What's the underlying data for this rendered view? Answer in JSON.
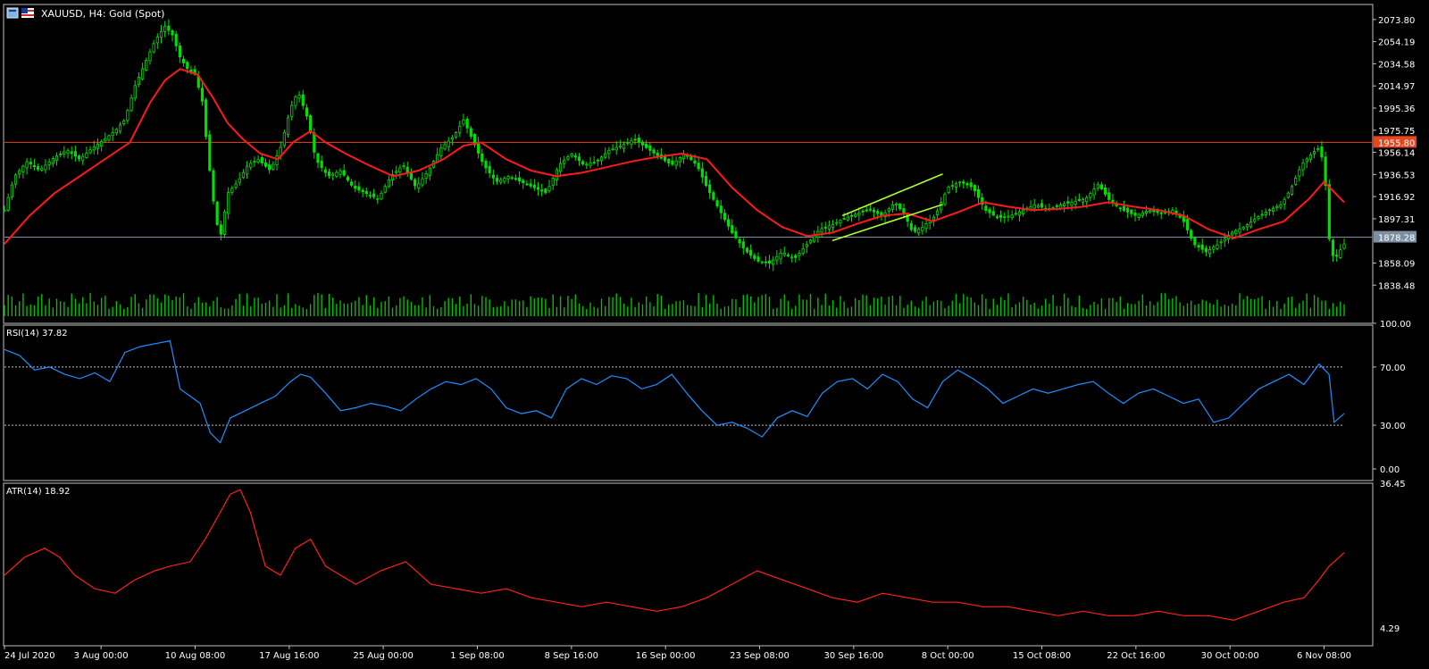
{
  "window": {
    "title": "XAUUSD, H4:  Gold (Spot)",
    "icon_names": [
      "chart-window-icon",
      "flag-icon"
    ]
  },
  "colors": {
    "background": "#000000",
    "frame": "#c0c0c0",
    "text": "#ffffff",
    "candle": "#00e000",
    "volume": "#00c000",
    "ma": "#ff1a1a",
    "resistance_line": "#e5461e",
    "support_line": "#7d8fa3",
    "channel": "#adff2f",
    "rsi": "#1e90ff",
    "atr": "#ff2020",
    "level_dotted": "#c0c0c0"
  },
  "chart_data": [
    {
      "name": "main",
      "type": "candlestick",
      "symbol": "XAUUSD",
      "timeframe": "H4",
      "title": "XAUUSD, H4:  Gold (Spot)",
      "ylim": [
        1830,
        2080
      ],
      "y_ticks": [
        "2073.80",
        "2054.19",
        "2034.58",
        "2014.97",
        "1995.36",
        "1975.75",
        "1956.14",
        "1936.53",
        "1916.92",
        "1897.31",
        "1858.09",
        "1838.48"
      ],
      "x_ticks": [
        "24 Jul 2020",
        "3 Aug 00:00",
        "10 Aug 08:00",
        "17 Aug 16:00",
        "25 Aug 00:00",
        "1 Sep 08:00",
        "8 Sep 16:00",
        "16 Sep 00:00",
        "23 Sep 08:00",
        "30 Sep 16:00",
        "8 Oct 00:00",
        "15 Oct 08:00",
        "22 Oct 16:00",
        "30 Oct 00:00",
        "6 Nov 08:00"
      ],
      "horizontal_lines": [
        {
          "label": "1955.80",
          "value": 1965
        },
        {
          "label": "1878.28",
          "value": 1881
        }
      ],
      "close_path": [
        {
          "x": 0,
          "y": 1905
        },
        {
          "x": 0.4,
          "y": 1935
        },
        {
          "x": 0.9,
          "y": 1948
        },
        {
          "x": 1.4,
          "y": 1940
        },
        {
          "x": 2.0,
          "y": 1952
        },
        {
          "x": 2.5,
          "y": 1958
        },
        {
          "x": 3.0,
          "y": 1950
        },
        {
          "x": 3.5,
          "y": 1960
        },
        {
          "x": 4.0,
          "y": 1968
        },
        {
          "x": 4.4,
          "y": 1975
        },
        {
          "x": 4.8,
          "y": 1985
        },
        {
          "x": 5.2,
          "y": 2015
        },
        {
          "x": 5.6,
          "y": 2035
        },
        {
          "x": 6.0,
          "y": 2055
        },
        {
          "x": 6.4,
          "y": 2068
        },
        {
          "x": 6.7,
          "y": 2060
        },
        {
          "x": 7.0,
          "y": 2040
        },
        {
          "x": 7.3,
          "y": 2030
        },
        {
          "x": 7.6,
          "y": 2025
        },
        {
          "x": 7.9,
          "y": 2000
        },
        {
          "x": 8.1,
          "y": 1955
        },
        {
          "x": 8.4,
          "y": 1900
        },
        {
          "x": 8.6,
          "y": 1880
        },
        {
          "x": 8.9,
          "y": 1920
        },
        {
          "x": 9.3,
          "y": 1930
        },
        {
          "x": 9.7,
          "y": 1945
        },
        {
          "x": 10.1,
          "y": 1950
        },
        {
          "x": 10.6,
          "y": 1940
        },
        {
          "x": 11.0,
          "y": 1960
        },
        {
          "x": 11.4,
          "y": 1995
        },
        {
          "x": 11.7,
          "y": 2010
        },
        {
          "x": 12.1,
          "y": 1985
        },
        {
          "x": 12.4,
          "y": 1950
        },
        {
          "x": 12.9,
          "y": 1935
        },
        {
          "x": 13.4,
          "y": 1940
        },
        {
          "x": 13.9,
          "y": 1925
        },
        {
          "x": 14.4,
          "y": 1920
        },
        {
          "x": 14.9,
          "y": 1915
        },
        {
          "x": 15.4,
          "y": 1935
        },
        {
          "x": 15.9,
          "y": 1945
        },
        {
          "x": 16.4,
          "y": 1925
        },
        {
          "x": 16.9,
          "y": 1940
        },
        {
          "x": 17.4,
          "y": 1960
        },
        {
          "x": 17.9,
          "y": 1970
        },
        {
          "x": 18.3,
          "y": 1985
        },
        {
          "x": 18.7,
          "y": 1965
        },
        {
          "x": 19.1,
          "y": 1945
        },
        {
          "x": 19.6,
          "y": 1930
        },
        {
          "x": 20.1,
          "y": 1935
        },
        {
          "x": 20.6,
          "y": 1930
        },
        {
          "x": 21.1,
          "y": 1925
        },
        {
          "x": 21.6,
          "y": 1920
        },
        {
          "x": 22.1,
          "y": 1945
        },
        {
          "x": 22.6,
          "y": 1955
        },
        {
          "x": 23.1,
          "y": 1945
        },
        {
          "x": 23.6,
          "y": 1948
        },
        {
          "x": 24.1,
          "y": 1958
        },
        {
          "x": 24.6,
          "y": 1962
        },
        {
          "x": 25.1,
          "y": 1968
        },
        {
          "x": 25.6,
          "y": 1960
        },
        {
          "x": 26.1,
          "y": 1952
        },
        {
          "x": 26.6,
          "y": 1945
        },
        {
          "x": 27.1,
          "y": 1955
        },
        {
          "x": 27.6,
          "y": 1945
        },
        {
          "x": 28.0,
          "y": 1925
        },
        {
          "x": 28.5,
          "y": 1905
        },
        {
          "x": 29.0,
          "y": 1885
        },
        {
          "x": 29.5,
          "y": 1870
        },
        {
          "x": 30.0,
          "y": 1860
        },
        {
          "x": 30.5,
          "y": 1858
        },
        {
          "x": 31.0,
          "y": 1868
        },
        {
          "x": 31.5,
          "y": 1862
        },
        {
          "x": 32.0,
          "y": 1875
        },
        {
          "x": 32.5,
          "y": 1888
        },
        {
          "x": 33.0,
          "y": 1892
        },
        {
          "x": 33.5,
          "y": 1898
        },
        {
          "x": 34.0,
          "y": 1902
        },
        {
          "x": 34.5,
          "y": 1905
        },
        {
          "x": 35.0,
          "y": 1900
        },
        {
          "x": 35.5,
          "y": 1912
        },
        {
          "x": 35.9,
          "y": 1900
        },
        {
          "x": 36.2,
          "y": 1885
        },
        {
          "x": 36.6,
          "y": 1890
        },
        {
          "x": 37.1,
          "y": 1900
        },
        {
          "x": 37.6,
          "y": 1925
        },
        {
          "x": 38.1,
          "y": 1930
        },
        {
          "x": 38.6,
          "y": 1925
        },
        {
          "x": 39.1,
          "y": 1905
        },
        {
          "x": 39.6,
          "y": 1898
        },
        {
          "x": 40.1,
          "y": 1900
        },
        {
          "x": 40.6,
          "y": 1905
        },
        {
          "x": 41.1,
          "y": 1910
        },
        {
          "x": 41.6,
          "y": 1905
        },
        {
          "x": 42.1,
          "y": 1910
        },
        {
          "x": 42.6,
          "y": 1912
        },
        {
          "x": 43.1,
          "y": 1915
        },
        {
          "x": 43.6,
          "y": 1928
        },
        {
          "x": 44.1,
          "y": 1912
        },
        {
          "x": 44.6,
          "y": 1905
        },
        {
          "x": 45.1,
          "y": 1900
        },
        {
          "x": 45.6,
          "y": 1905
        },
        {
          "x": 46.1,
          "y": 1902
        },
        {
          "x": 46.6,
          "y": 1905
        },
        {
          "x": 47.0,
          "y": 1895
        },
        {
          "x": 47.4,
          "y": 1875
        },
        {
          "x": 47.9,
          "y": 1868
        },
        {
          "x": 48.4,
          "y": 1875
        },
        {
          "x": 48.9,
          "y": 1885
        },
        {
          "x": 49.4,
          "y": 1890
        },
        {
          "x": 49.9,
          "y": 1898
        },
        {
          "x": 50.4,
          "y": 1905
        },
        {
          "x": 50.9,
          "y": 1910
        },
        {
          "x": 51.3,
          "y": 1925
        },
        {
          "x": 51.7,
          "y": 1945
        },
        {
          "x": 52.1,
          "y": 1955
        },
        {
          "x": 52.4,
          "y": 1960
        },
        {
          "x": 52.6,
          "y": 1945
        },
        {
          "x": 52.8,
          "y": 1880
        },
        {
          "x": 53.0,
          "y": 1860
        },
        {
          "x": 53.2,
          "y": 1868
        },
        {
          "x": 53.4,
          "y": 1875
        }
      ],
      "ma_path": [
        {
          "x": 0,
          "y": 1875
        },
        {
          "x": 1.0,
          "y": 1900
        },
        {
          "x": 2.0,
          "y": 1920
        },
        {
          "x": 3.0,
          "y": 1935
        },
        {
          "x": 4.0,
          "y": 1950
        },
        {
          "x": 5.0,
          "y": 1965
        },
        {
          "x": 5.8,
          "y": 2000
        },
        {
          "x": 6.4,
          "y": 2020
        },
        {
          "x": 7.0,
          "y": 2030
        },
        {
          "x": 7.7,
          "y": 2025
        },
        {
          "x": 8.3,
          "y": 2005
        },
        {
          "x": 8.9,
          "y": 1982
        },
        {
          "x": 9.5,
          "y": 1968
        },
        {
          "x": 10.2,
          "y": 1955
        },
        {
          "x": 10.9,
          "y": 1950
        },
        {
          "x": 11.5,
          "y": 1965
        },
        {
          "x": 12.2,
          "y": 1975
        },
        {
          "x": 12.8,
          "y": 1965
        },
        {
          "x": 13.6,
          "y": 1955
        },
        {
          "x": 14.5,
          "y": 1945
        },
        {
          "x": 15.5,
          "y": 1935
        },
        {
          "x": 16.5,
          "y": 1940
        },
        {
          "x": 17.5,
          "y": 1950
        },
        {
          "x": 18.3,
          "y": 1962
        },
        {
          "x": 19.0,
          "y": 1965
        },
        {
          "x": 20.0,
          "y": 1950
        },
        {
          "x": 21.0,
          "y": 1940
        },
        {
          "x": 22.0,
          "y": 1935
        },
        {
          "x": 23.0,
          "y": 1938
        },
        {
          "x": 24.0,
          "y": 1943
        },
        {
          "x": 25.0,
          "y": 1948
        },
        {
          "x": 26.0,
          "y": 1952
        },
        {
          "x": 27.0,
          "y": 1955
        },
        {
          "x": 28.0,
          "y": 1950
        },
        {
          "x": 29.0,
          "y": 1925
        },
        {
          "x": 30.0,
          "y": 1905
        },
        {
          "x": 31.0,
          "y": 1890
        },
        {
          "x": 32.0,
          "y": 1882
        },
        {
          "x": 33.0,
          "y": 1885
        },
        {
          "x": 34.0,
          "y": 1893
        },
        {
          "x": 35.0,
          "y": 1900
        },
        {
          "x": 36.0,
          "y": 1902
        },
        {
          "x": 37.0,
          "y": 1895
        },
        {
          "x": 38.0,
          "y": 1903
        },
        {
          "x": 39.0,
          "y": 1912
        },
        {
          "x": 40.0,
          "y": 1908
        },
        {
          "x": 41.0,
          "y": 1905
        },
        {
          "x": 42.0,
          "y": 1906
        },
        {
          "x": 43.0,
          "y": 1908
        },
        {
          "x": 44.0,
          "y": 1912
        },
        {
          "x": 45.0,
          "y": 1908
        },
        {
          "x": 46.0,
          "y": 1905
        },
        {
          "x": 47.0,
          "y": 1900
        },
        {
          "x": 48.0,
          "y": 1888
        },
        {
          "x": 49.0,
          "y": 1880
        },
        {
          "x": 50.0,
          "y": 1888
        },
        {
          "x": 51.0,
          "y": 1895
        },
        {
          "x": 52.0,
          "y": 1915
        },
        {
          "x": 52.6,
          "y": 1930
        },
        {
          "x": 53.4,
          "y": 1912
        }
      ],
      "channel_lines": [
        {
          "from": {
            "x": 33.0,
            "y": 1878
          },
          "to": {
            "x": 37.4,
            "y": 1910
          }
        },
        {
          "from": {
            "x": 33.4,
            "y": 1900
          },
          "to": {
            "x": 37.4,
            "y": 1937
          }
        }
      ]
    },
    {
      "name": "rsi",
      "type": "line",
      "label": "RSI(14) 37.82",
      "ylim": [
        0,
        100
      ],
      "y_ticks": [
        "100.00",
        "70.00",
        "30.00",
        "0.00"
      ],
      "levels": [
        70,
        30
      ],
      "x": [
        0,
        0.6,
        1.2,
        1.8,
        2.4,
        3.0,
        3.6,
        4.2,
        4.8,
        5.4,
        6.0,
        6.6,
        7.0,
        7.4,
        7.8,
        8.2,
        8.6,
        9.0,
        9.6,
        10.2,
        10.8,
        11.4,
        11.8,
        12.2,
        12.8,
        13.4,
        14.0,
        14.6,
        15.2,
        15.8,
        16.4,
        17.0,
        17.6,
        18.2,
        18.8,
        19.4,
        20.0,
        20.6,
        21.2,
        21.8,
        22.4,
        23.0,
        23.6,
        24.2,
        24.8,
        25.4,
        26.0,
        26.6,
        27.2,
        27.8,
        28.4,
        29.0,
        29.6,
        30.2,
        30.8,
        31.4,
        32.0,
        32.6,
        33.2,
        33.8,
        34.4,
        35.0,
        35.6,
        36.2,
        36.8,
        37.4,
        38.0,
        38.6,
        39.2,
        39.8,
        40.4,
        41.0,
        41.6,
        42.2,
        42.8,
        43.4,
        44.0,
        44.6,
        45.2,
        45.8,
        46.4,
        47.0,
        47.6,
        48.2,
        48.8,
        49.4,
        50.0,
        50.6,
        51.2,
        51.8,
        52.4,
        52.8,
        53.0,
        53.4
      ],
      "values": [
        82,
        78,
        68,
        70,
        65,
        62,
        66,
        60,
        80,
        84,
        86,
        88,
        55,
        50,
        45,
        25,
        18,
        35,
        40,
        45,
        50,
        60,
        65,
        63,
        52,
        40,
        42,
        45,
        43,
        40,
        48,
        55,
        60,
        58,
        62,
        55,
        42,
        38,
        40,
        35,
        55,
        62,
        58,
        64,
        62,
        55,
        58,
        65,
        52,
        40,
        30,
        32,
        28,
        22,
        35,
        40,
        36,
        52,
        60,
        62,
        55,
        65,
        60,
        48,
        42,
        60,
        68,
        62,
        55,
        45,
        50,
        55,
        52,
        55,
        58,
        60,
        52,
        45,
        52,
        55,
        50,
        45,
        48,
        32,
        35,
        45,
        55,
        60,
        65,
        58,
        72,
        65,
        32,
        38
      ]
    },
    {
      "name": "atr",
      "type": "line",
      "label": "ATR(14) 18.92",
      "ylim": [
        4.29,
        36.45
      ],
      "y_ticks": [
        "36.45",
        "4.29"
      ],
      "x": [
        0,
        0.8,
        1.6,
        2.2,
        2.8,
        3.6,
        4.4,
        5.2,
        6.0,
        6.6,
        7.4,
        8.0,
        8.6,
        9.0,
        9.4,
        9.8,
        10.4,
        11.0,
        11.6,
        12.2,
        12.8,
        13.4,
        14.0,
        15.0,
        16.0,
        17.0,
        18.0,
        19.0,
        20.0,
        21.0,
        22.0,
        23.0,
        24.0,
        25.0,
        26.0,
        27.0,
        28.0,
        29.0,
        30.0,
        31.0,
        32.0,
        33.0,
        34.0,
        35.0,
        36.0,
        37.0,
        38.0,
        39.0,
        40.0,
        41.0,
        42.0,
        43.0,
        44.0,
        45.0,
        46.0,
        47.0,
        48.0,
        49.0,
        50.0,
        51.0,
        51.8,
        52.4,
        52.8,
        53.0,
        53.4
      ],
      "values": [
        16,
        20,
        22,
        20,
        16,
        13,
        12,
        15,
        17,
        18,
        19,
        24,
        30,
        34,
        35,
        30,
        18,
        16,
        22,
        24,
        18,
        16,
        14,
        17,
        19,
        14,
        13,
        12,
        13,
        11,
        10,
        9,
        10,
        9,
        8,
        9,
        11,
        14,
        17,
        15,
        13,
        11,
        10,
        12,
        11,
        10,
        10,
        9,
        9,
        8,
        7,
        8,
        7,
        7,
        8,
        7,
        7,
        6,
        8,
        10,
        11,
        15,
        18,
        19,
        21
      ]
    }
  ]
}
